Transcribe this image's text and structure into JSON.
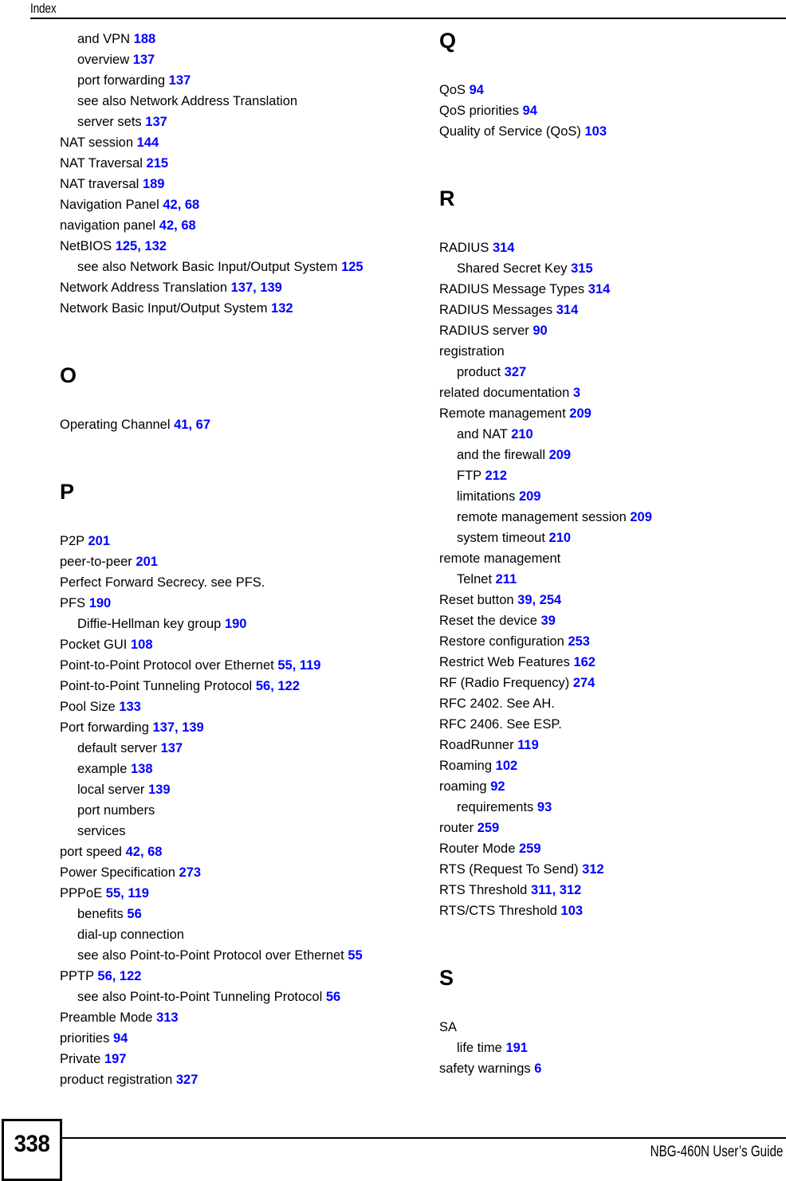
{
  "header": {
    "title": "Index"
  },
  "footer": {
    "page_number": "338",
    "doc_title": "NBG-460N User’s Guide"
  },
  "colors": {
    "page_number_link": "#0000FF",
    "text": "#000000"
  },
  "columns": [
    {
      "name": "left-column",
      "blocks": [
        {
          "letter": null,
          "entries": [
            {
              "level": 1,
              "term": "and VPN",
              "pages": [
                "188"
              ]
            },
            {
              "level": 1,
              "term": "overview",
              "pages": [
                "137"
              ]
            },
            {
              "level": 1,
              "term": "port forwarding",
              "pages": [
                "137"
              ]
            },
            {
              "level": 1,
              "term": "see also Network Address Translation",
              "pages": []
            },
            {
              "level": 1,
              "term": "server sets",
              "pages": [
                "137"
              ]
            },
            {
              "level": 0,
              "term": "NAT session",
              "pages": [
                "144"
              ]
            },
            {
              "level": 0,
              "term": "NAT Traversal",
              "pages": [
                "215"
              ]
            },
            {
              "level": 0,
              "term": "NAT traversal",
              "pages": [
                "189"
              ]
            },
            {
              "level": 0,
              "term": "Navigation Panel",
              "pages": [
                "42",
                "68"
              ]
            },
            {
              "level": 0,
              "term": "navigation panel",
              "pages": [
                "42",
                "68"
              ]
            },
            {
              "level": 0,
              "term": "NetBIOS",
              "pages": [
                "125",
                "132"
              ]
            },
            {
              "level": 1,
              "term": "see also Network Basic Input/Output System",
              "pages": [
                "125"
              ]
            },
            {
              "level": 0,
              "term": "Network Address Translation",
              "pages": [
                "137",
                "139"
              ]
            },
            {
              "level": 0,
              "term": "Network Basic Input/Output System",
              "pages": [
                "132"
              ]
            }
          ]
        },
        {
          "letter": "O",
          "entries": [
            {
              "level": 0,
              "term": "Operating Channel",
              "pages": [
                "41",
                "67"
              ]
            }
          ]
        },
        {
          "letter": "P",
          "entries": [
            {
              "level": 0,
              "term": "P2P",
              "pages": [
                "201"
              ]
            },
            {
              "level": 0,
              "term": "peer-to-peer",
              "pages": [
                "201"
              ]
            },
            {
              "level": 0,
              "term": "Perfect Forward Secrecy. see PFS.",
              "pages": []
            },
            {
              "level": 0,
              "term": "PFS",
              "pages": [
                "190"
              ]
            },
            {
              "level": 1,
              "term": "Diffie-Hellman key group",
              "pages": [
                "190"
              ]
            },
            {
              "level": 0,
              "term": "Pocket GUI",
              "pages": [
                "108"
              ]
            },
            {
              "level": 0,
              "term": "Point-to-Point Protocol over Ethernet",
              "pages": [
                "55",
                "119"
              ]
            },
            {
              "level": 0,
              "term": "Point-to-Point Tunneling Protocol",
              "pages": [
                "56",
                "122"
              ]
            },
            {
              "level": 0,
              "term": "Pool Size",
              "pages": [
                "133"
              ]
            },
            {
              "level": 0,
              "term": "Port forwarding",
              "pages": [
                "137",
                "139"
              ]
            },
            {
              "level": 1,
              "term": "default server",
              "pages": [
                "137"
              ]
            },
            {
              "level": 1,
              "term": "example",
              "pages": [
                "138"
              ]
            },
            {
              "level": 1,
              "term": "local server",
              "pages": [
                "139"
              ]
            },
            {
              "level": 1,
              "term": "port numbers",
              "pages": []
            },
            {
              "level": 1,
              "term": "services",
              "pages": []
            },
            {
              "level": 0,
              "term": "port speed",
              "pages": [
                "42",
                "68"
              ]
            },
            {
              "level": 0,
              "term": "Power Specification",
              "pages": [
                "273"
              ]
            },
            {
              "level": 0,
              "term": "PPPoE",
              "pages": [
                "55",
                "119"
              ]
            },
            {
              "level": 1,
              "term": "benefits",
              "pages": [
                "56"
              ]
            },
            {
              "level": 1,
              "term": "dial-up connection",
              "pages": []
            },
            {
              "level": 1,
              "term": "see also Point-to-Point Protocol over Ethernet",
              "pages": [
                "55"
              ]
            },
            {
              "level": 0,
              "term": "PPTP",
              "pages": [
                "56",
                "122"
              ]
            },
            {
              "level": 1,
              "term": "see also Point-to-Point Tunneling Protocol",
              "pages": [
                "56"
              ]
            },
            {
              "level": 0,
              "term": "Preamble Mode",
              "pages": [
                "313"
              ]
            },
            {
              "level": 0,
              "term": "priorities",
              "pages": [
                "94"
              ]
            },
            {
              "level": 0,
              "term": "Private",
              "pages": [
                "197"
              ]
            },
            {
              "level": 0,
              "term": "product registration",
              "pages": [
                "327"
              ]
            }
          ]
        }
      ]
    },
    {
      "name": "right-column",
      "blocks": [
        {
          "letter": "Q",
          "entries": [
            {
              "level": 0,
              "term": "QoS",
              "pages": [
                "94"
              ]
            },
            {
              "level": 0,
              "term": "QoS priorities",
              "pages": [
                "94"
              ]
            },
            {
              "level": 0,
              "term": "Quality of Service (QoS)",
              "pages": [
                "103"
              ]
            }
          ]
        },
        {
          "letter": "R",
          "entries": [
            {
              "level": 0,
              "term": "RADIUS",
              "pages": [
                "314"
              ]
            },
            {
              "level": 1,
              "term": "Shared Secret Key",
              "pages": [
                "315"
              ]
            },
            {
              "level": 0,
              "term": "RADIUS Message Types",
              "pages": [
                "314"
              ]
            },
            {
              "level": 0,
              "term": "RADIUS Messages",
              "pages": [
                "314"
              ]
            },
            {
              "level": 0,
              "term": "RADIUS server",
              "pages": [
                "90"
              ]
            },
            {
              "level": 0,
              "term": "registration",
              "pages": []
            },
            {
              "level": 1,
              "term": "product",
              "pages": [
                "327"
              ]
            },
            {
              "level": 0,
              "term": "related documentation",
              "pages": [
                "3"
              ]
            },
            {
              "level": 0,
              "term": "Remote management",
              "pages": [
                "209"
              ]
            },
            {
              "level": 1,
              "term": "and NAT",
              "pages": [
                "210"
              ]
            },
            {
              "level": 1,
              "term": "and the firewall",
              "pages": [
                "209"
              ]
            },
            {
              "level": 1,
              "term": "FTP",
              "pages": [
                "212"
              ]
            },
            {
              "level": 1,
              "term": "limitations",
              "pages": [
                "209"
              ]
            },
            {
              "level": 1,
              "term": "remote management session",
              "pages": [
                "209"
              ]
            },
            {
              "level": 1,
              "term": "system timeout",
              "pages": [
                "210"
              ]
            },
            {
              "level": 0,
              "term": "remote management",
              "pages": []
            },
            {
              "level": 1,
              "term": "Telnet",
              "pages": [
                "211"
              ]
            },
            {
              "level": 0,
              "term": "Reset button",
              "pages": [
                "39",
                "254"
              ]
            },
            {
              "level": 0,
              "term": "Reset the device",
              "pages": [
                "39"
              ]
            },
            {
              "level": 0,
              "term": "Restore configuration",
              "pages": [
                "253"
              ]
            },
            {
              "level": 0,
              "term": "Restrict Web Features",
              "pages": [
                "162"
              ]
            },
            {
              "level": 0,
              "term": "RF (Radio Frequency)",
              "pages": [
                "274"
              ]
            },
            {
              "level": 0,
              "term": "RFC 2402. See AH.",
              "pages": []
            },
            {
              "level": 0,
              "term": "RFC 2406. See ESP.",
              "pages": []
            },
            {
              "level": 0,
              "term": "RoadRunner",
              "pages": [
                "119"
              ]
            },
            {
              "level": 0,
              "term": "Roaming",
              "pages": [
                "102"
              ]
            },
            {
              "level": 0,
              "term": "roaming",
              "pages": [
                "92"
              ]
            },
            {
              "level": 1,
              "term": "requirements",
              "pages": [
                "93"
              ]
            },
            {
              "level": 0,
              "term": "router",
              "pages": [
                "259"
              ]
            },
            {
              "level": 0,
              "term": "Router Mode",
              "pages": [
                "259"
              ]
            },
            {
              "level": 0,
              "term": "RTS (Request To Send)",
              "pages": [
                "312"
              ]
            },
            {
              "level": 0,
              "term": "RTS Threshold",
              "pages": [
                "311",
                "312"
              ]
            },
            {
              "level": 0,
              "term": "RTS/CTS Threshold",
              "pages": [
                "103"
              ]
            }
          ]
        },
        {
          "letter": "S",
          "entries": [
            {
              "level": 0,
              "term": "SA",
              "pages": []
            },
            {
              "level": 1,
              "term": "life time",
              "pages": [
                "191"
              ]
            },
            {
              "level": 0,
              "term": "safety warnings",
              "pages": [
                "6"
              ]
            }
          ]
        }
      ]
    }
  ]
}
